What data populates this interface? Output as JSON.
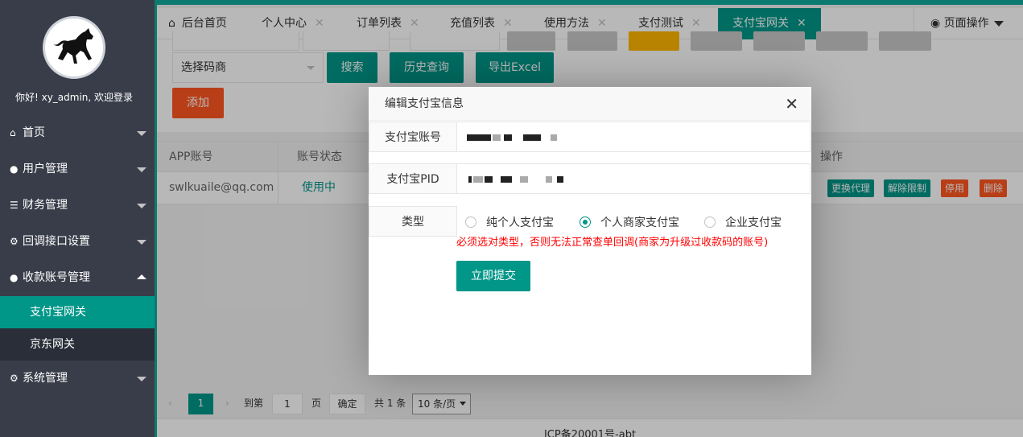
{
  "sidebar": {
    "welcome": "你好! xy_admin, 欢迎登录",
    "items": [
      {
        "icon": "home-icon",
        "glyph": "⌂",
        "label": "首页"
      },
      {
        "icon": "user-icon",
        "glyph": "●",
        "label": "用户管理"
      },
      {
        "icon": "list-icon",
        "glyph": "☰",
        "label": "财务管理"
      },
      {
        "icon": "gear-icon",
        "glyph": "⚙",
        "label": "回调接口设置"
      },
      {
        "icon": "users-icon",
        "glyph": "●",
        "label": "收款账号管理"
      }
    ],
    "sub_items": [
      "支付宝网关",
      "京东网关"
    ],
    "system": {
      "icon": "gear-icon",
      "glyph": "⚙",
      "label": "系统管理"
    }
  },
  "tabs": [
    "后台首页",
    "个人中心",
    "订单列表",
    "充值列表",
    "使用方法",
    "支付测试",
    "支付宝网关"
  ],
  "page_ops": "页面操作",
  "toolbar": {
    "select_placeholder": "选择码商",
    "search": "搜索",
    "history": "历史查询",
    "export": "导出Excel",
    "add": "添加"
  },
  "table": {
    "headers": [
      "APP账号",
      "账号状态",
      "操作"
    ],
    "row": {
      "account": "swlkuaile@qq.com",
      "status": "使用中",
      "actions": [
        "更换代理",
        "解除限制",
        "停用",
        "删除"
      ]
    }
  },
  "pager": {
    "page": "1",
    "goto": "到第",
    "input": "1",
    "page_unit": "页",
    "confirm": "确定",
    "total": "共 1 条",
    "per_page": "10 条/页"
  },
  "footer": "ICP备20001号-abt",
  "modal": {
    "title": "编辑支付宝信息",
    "close": "✕",
    "account_label": "支付宝账号",
    "pid_label": "支付宝PID",
    "type_label": "类型",
    "types": [
      "纯个人支付宝",
      "个人商家支付宝",
      "企业支付宝"
    ],
    "selected_type": "个人商家支付宝",
    "warning": "必须选对类型，否则无法正常查单回调(商家为升级过收款码的账号)",
    "submit": "立即提交"
  },
  "colors": {
    "primary": "#009688",
    "sidebar": "#393d49",
    "danger": "#ff5722",
    "warning_text": "#ff0000"
  }
}
